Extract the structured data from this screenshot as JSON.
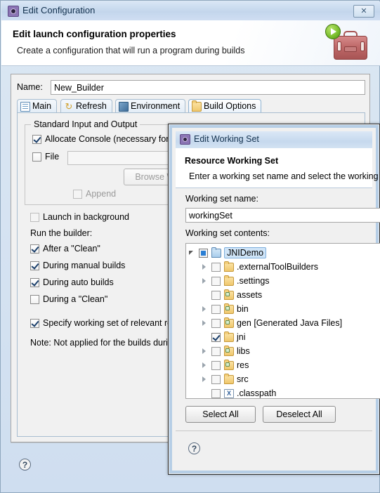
{
  "back_window": {
    "title": "Edit Configuration",
    "title_icon": "gear-icon",
    "close_label": "✕",
    "banner": {
      "heading": "Edit launch configuration properties",
      "subheading": "Create a configuration that will run a program during builds",
      "icon": "toolbox-run-icon"
    },
    "name_field": {
      "label": "Name:",
      "value": "New_Builder"
    },
    "tabs": [
      {
        "label": "Main",
        "icon": "document-icon",
        "selected": false
      },
      {
        "label": "Refresh",
        "icon": "refresh-icon",
        "selected": false
      },
      {
        "label": "Environment",
        "icon": "environment-icon",
        "selected": false
      },
      {
        "label": "Build Options",
        "icon": "folder-icon",
        "selected": true
      }
    ],
    "group": {
      "caption": "Standard Input and Output",
      "allocate_console": {
        "label": "Allocate Console (necessary for i",
        "checked": true
      },
      "file": {
        "label": "File",
        "checked": false,
        "value": ""
      },
      "browse_workspace": "Browse Worksp",
      "append": {
        "label": "Append",
        "checked": false,
        "enabled": false
      }
    },
    "launch_in_background": {
      "label": "Launch in background",
      "checked": false
    },
    "run_the_builder_label": "Run the builder:",
    "build_options": [
      {
        "label": "After a \"Clean\"",
        "checked": true
      },
      {
        "label": "During manual builds",
        "checked": true
      },
      {
        "label": "During auto builds",
        "checked": true
      },
      {
        "label": "During a \"Clean\"",
        "checked": false
      }
    ],
    "specify_working_set": {
      "label": "Specify working set of relevant res",
      "checked": true
    },
    "note": "Note: Not applied for the builds duri",
    "help_icon": "?"
  },
  "front_window": {
    "title": "Edit Working Set",
    "title_icon": "gear-icon",
    "banner": {
      "heading": "Resource Working Set",
      "subheading": "Enter a working set name and select the working"
    },
    "working_set_name": {
      "label": "Working set name:",
      "value": "workingSet"
    },
    "contents_label": "Working set contents:",
    "tree": [
      {
        "label": "JNIDemo",
        "indent": 0,
        "check": "part",
        "twisty": "open",
        "icon": "project-folder-icon",
        "selected": true
      },
      {
        "label": ".externalToolBuilders",
        "indent": 1,
        "check": "off",
        "twisty": "closed",
        "icon": "folder-icon",
        "selected": false
      },
      {
        "label": ".settings",
        "indent": 1,
        "check": "off",
        "twisty": "closed",
        "icon": "folder-icon",
        "selected": false
      },
      {
        "label": "assets",
        "indent": 1,
        "check": "off",
        "twisty": "none",
        "icon": "source-folder-icon",
        "selected": false
      },
      {
        "label": "bin",
        "indent": 1,
        "check": "off",
        "twisty": "closed",
        "icon": "source-folder-icon",
        "selected": false
      },
      {
        "label": "gen [Generated Java Files]",
        "indent": 1,
        "check": "off",
        "twisty": "closed",
        "icon": "source-folder-icon",
        "selected": false
      },
      {
        "label": "jni",
        "indent": 1,
        "check": "on",
        "twisty": "none",
        "icon": "folder-icon",
        "selected": false
      },
      {
        "label": "libs",
        "indent": 1,
        "check": "off",
        "twisty": "closed",
        "icon": "source-folder-icon",
        "selected": false
      },
      {
        "label": "res",
        "indent": 1,
        "check": "off",
        "twisty": "closed",
        "icon": "source-folder-icon",
        "selected": false
      },
      {
        "label": "src",
        "indent": 1,
        "check": "off",
        "twisty": "closed",
        "icon": "folder-icon",
        "selected": false
      },
      {
        "label": ".classpath",
        "indent": 1,
        "check": "off",
        "twisty": "none",
        "icon": "xml-file-icon",
        "selected": false
      }
    ],
    "select_all_label": "Select All",
    "deselect_all_label": "Deselect All",
    "help_icon": "?"
  },
  "colors": {
    "titlebar": "#c6d9ee",
    "panel": "#f1f1f1",
    "selection": "#cfe4f7",
    "accent_blue": "#2b7fd4",
    "folder_yellow": "#efc76c",
    "toolbox_red": "#bf6a6a",
    "play_green": "#78bd2b"
  }
}
